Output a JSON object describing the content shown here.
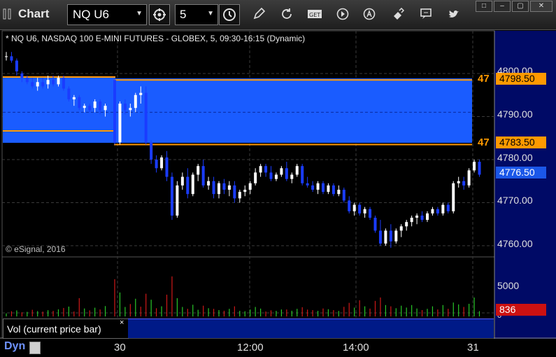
{
  "window": {
    "title": "Chart",
    "close_label": "✕"
  },
  "toolbar": {
    "symbol": "NQ U6",
    "interval": "5",
    "tools": [
      "link-icon",
      "pencil-icon",
      "refresh-icon",
      "get-icon",
      "play-icon",
      "alert-icon",
      "drawing-icon",
      "comment-icon",
      "twitter-icon"
    ]
  },
  "chart": {
    "header": "* NQ U6, NASDAQ 100 E-MINI FUTURES - GLOBEX, 5, 09:30-16:15 (Dynamic)",
    "copyright": "© eSignal, 2016",
    "price_axis": [
      "4800.00",
      "4790.00",
      "4780.00",
      "4770.00",
      "4760.00"
    ],
    "price_tags": {
      "upper": "4798.50",
      "lower": "4783.50",
      "last": "4776.50"
    },
    "zone_labels": {
      "upper": "47",
      "lower": "47"
    },
    "colors": {
      "zone": "#1a5cff",
      "zone_border": "#ff9900",
      "up": "#ffffff",
      "down": "#1a3cff",
      "last_tag": "#1b57e8"
    }
  },
  "volume": {
    "label": "Vol (current price bar)",
    "close": "×",
    "axis": [
      "5000",
      "0"
    ],
    "last_value": "836",
    "colors": {
      "up": "#28c728",
      "down": "#d01818",
      "tag": "#cc1111"
    }
  },
  "footer": {
    "mode": "Dyn",
    "time_labels": [
      "30",
      "12:00",
      "14:00",
      "31"
    ]
  },
  "chart_data": {
    "type": "candlestick",
    "interval": "5",
    "symbol": "NQ U6",
    "ylim": [
      4758,
      4808
    ],
    "horizontal_lines": [
      4798.5,
      4783.5
    ],
    "last_price": 4776.5,
    "bars": [
      [
        4804,
        4805,
        4803,
        4804
      ],
      [
        4804,
        4805,
        4802.5,
        4803
      ],
      [
        4803,
        4803.5,
        4799.5,
        4800.5
      ],
      [
        4800,
        4800.5,
        4798,
        4799
      ],
      [
        4799,
        4799.5,
        4797.5,
        4798
      ],
      [
        4798,
        4799,
        4796.5,
        4797
      ],
      [
        4797,
        4799,
        4796,
        4798
      ],
      [
        4798,
        4799,
        4796.5,
        4797
      ],
      [
        4797.5,
        4799.5,
        4796.5,
        4798.5
      ],
      [
        4798.5,
        4799.5,
        4797,
        4797.5
      ],
      [
        4797.5,
        4799.5,
        4797,
        4799
      ],
      [
        4799,
        4799.5,
        4796,
        4796.5
      ],
      [
        4796.5,
        4797,
        4793.5,
        4794
      ],
      [
        4794,
        4795,
        4792.5,
        4794.5
      ],
      [
        4794.5,
        4795,
        4791.5,
        4792
      ],
      [
        4792,
        4793,
        4791,
        4792.5
      ],
      [
        4792.5,
        4793,
        4791,
        4791.5
      ],
      [
        4792,
        4794,
        4791,
        4793.5
      ],
      [
        4793.5,
        4794,
        4790.5,
        4791.5
      ],
      [
        4791.5,
        4793,
        4790,
        4792.5
      ],
      [
        4798.5,
        4799,
        4783.5,
        4784
      ],
      [
        4784,
        4793.5,
        4783.5,
        4793
      ],
      [
        4793,
        4794,
        4790.5,
        4791.5
      ],
      [
        4791.5,
        4793,
        4790,
        4792
      ],
      [
        4792,
        4795.5,
        4791,
        4795
      ],
      [
        4795,
        4797,
        4793,
        4795.5
      ],
      [
        4795.5,
        4797,
        4783.5,
        4784
      ],
      [
        4784,
        4784.5,
        4779,
        4780
      ],
      [
        4780,
        4781,
        4777,
        4778
      ],
      [
        4778,
        4781,
        4777.5,
        4780.5
      ],
      [
        4780.5,
        4782,
        4775,
        4776
      ],
      [
        4776,
        4777,
        4766,
        4767
      ],
      [
        4767,
        4775,
        4766.5,
        4774
      ],
      [
        4774,
        4777,
        4773,
        4776
      ],
      [
        4776,
        4778,
        4771,
        4772
      ],
      [
        4772,
        4777,
        4771.5,
        4776.5
      ],
      [
        4776.5,
        4779,
        4775,
        4778.5
      ],
      [
        4778.5,
        4780,
        4773.5,
        4774
      ],
      [
        4774,
        4776,
        4773,
        4775
      ],
      [
        4775,
        4776,
        4771,
        4772
      ],
      [
        4772,
        4775,
        4771,
        4774.5
      ],
      [
        4774.5,
        4775.5,
        4772,
        4773
      ],
      [
        4773,
        4775,
        4771.5,
        4774
      ],
      [
        4774,
        4775,
        4770,
        4771
      ],
      [
        4771,
        4773,
        4770,
        4772.5
      ],
      [
        4772.5,
        4774,
        4771.5,
        4773
      ],
      [
        4773,
        4775,
        4772,
        4774.5
      ],
      [
        4774.5,
        4778,
        4774,
        4777
      ],
      [
        4777,
        4779,
        4776,
        4778.5
      ],
      [
        4778.5,
        4779,
        4776,
        4777
      ],
      [
        4777,
        4778.5,
        4775,
        4775.5
      ],
      [
        4775.5,
        4777,
        4775,
        4776.5
      ],
      [
        4776.5,
        4778.5,
        4776,
        4778
      ],
      [
        4778,
        4779.5,
        4775,
        4775.5
      ],
      [
        4775.5,
        4777,
        4774.5,
        4776.5
      ],
      [
        4776.5,
        4779,
        4776,
        4778.5
      ],
      [
        4778.5,
        4779,
        4774,
        4774.5
      ],
      [
        4774.5,
        4776,
        4773.5,
        4774
      ],
      [
        4774,
        4775,
        4772.5,
        4773
      ],
      [
        4773,
        4775,
        4772,
        4774.5
      ],
      [
        4774.5,
        4775,
        4772,
        4772.5
      ],
      [
        4772.5,
        4774.5,
        4772,
        4774
      ],
      [
        4774,
        4774.5,
        4771.5,
        4772
      ],
      [
        4772,
        4774,
        4771.5,
        4773
      ],
      [
        4773,
        4773.5,
        4770,
        4770.5
      ],
      [
        4770.5,
        4771.5,
        4767.5,
        4768
      ],
      [
        4768,
        4770,
        4767,
        4769.5
      ],
      [
        4769.5,
        4770,
        4767,
        4767.5
      ],
      [
        4767.5,
        4769,
        4766.5,
        4768.5
      ],
      [
        4768.5,
        4769,
        4766,
        4766.5
      ],
      [
        4766.5,
        4767,
        4763,
        4763.5
      ],
      [
        4763.5,
        4766,
        4760,
        4760.5
      ],
      [
        4760.5,
        4764,
        4760,
        4763.5
      ],
      [
        4763.5,
        4765,
        4759.5,
        4761
      ],
      [
        4761,
        4764,
        4760.5,
        4763.5
      ],
      [
        4763.5,
        4765,
        4762,
        4764.5
      ],
      [
        4764.5,
        4766,
        4763.5,
        4765.5
      ],
      [
        4765.5,
        4767,
        4764.5,
        4766.5
      ],
      [
        4766.5,
        4767.5,
        4765,
        4767
      ],
      [
        4767,
        4768,
        4765.5,
        4766
      ],
      [
        4766,
        4768,
        4765.5,
        4767.5
      ],
      [
        4767.5,
        4769,
        4767,
        4768.5
      ],
      [
        4768.5,
        4769,
        4767,
        4767.5
      ],
      [
        4767.5,
        4770,
        4767,
        4769.5
      ],
      [
        4769.5,
        4770,
        4767.5,
        4768
      ],
      [
        4768,
        4775,
        4767.5,
        4774.5
      ],
      [
        4774.5,
        4776,
        4773.5,
        4775
      ],
      [
        4775,
        4776,
        4773,
        4774
      ],
      [
        4774,
        4778,
        4773.5,
        4777.5
      ],
      [
        4777.5,
        4780,
        4777,
        4779.5
      ],
      [
        4779.5,
        4780,
        4776,
        4776.5
      ]
    ],
    "volume": [
      [
        480,
        1
      ],
      [
        820,
        0
      ],
      [
        950,
        1
      ],
      [
        650,
        0
      ],
      [
        720,
        1
      ],
      [
        1050,
        0
      ],
      [
        840,
        1
      ],
      [
        760,
        0
      ],
      [
        980,
        1
      ],
      [
        880,
        0
      ],
      [
        1120,
        1
      ],
      [
        1340,
        0
      ],
      [
        1560,
        1
      ],
      [
        780,
        0
      ],
      [
        2900,
        0
      ],
      [
        1260,
        1
      ],
      [
        960,
        0
      ],
      [
        1380,
        1
      ],
      [
        1100,
        0
      ],
      [
        1640,
        1
      ],
      [
        5900,
        0
      ],
      [
        3800,
        1
      ],
      [
        1500,
        1
      ],
      [
        1960,
        0
      ],
      [
        2800,
        1
      ],
      [
        1540,
        0
      ],
      [
        3600,
        0
      ],
      [
        2650,
        1
      ],
      [
        1300,
        0
      ],
      [
        1600,
        1
      ],
      [
        3450,
        0
      ],
      [
        6350,
        0
      ],
      [
        2900,
        1
      ],
      [
        1500,
        1
      ],
      [
        1200,
        0
      ],
      [
        1850,
        1
      ],
      [
        1050,
        1
      ],
      [
        1700,
        0
      ],
      [
        1300,
        1
      ],
      [
        1200,
        0
      ],
      [
        1000,
        1
      ],
      [
        900,
        0
      ],
      [
        1200,
        1
      ],
      [
        1600,
        0
      ],
      [
        880,
        1
      ],
      [
        820,
        1
      ],
      [
        1100,
        1
      ],
      [
        1500,
        1
      ],
      [
        1240,
        1
      ],
      [
        780,
        0
      ],
      [
        960,
        0
      ],
      [
        880,
        1
      ],
      [
        1100,
        1
      ],
      [
        1100,
        0
      ],
      [
        900,
        1
      ],
      [
        1200,
        1
      ],
      [
        1460,
        0
      ],
      [
        1080,
        0
      ],
      [
        1000,
        0
      ],
      [
        880,
        1
      ],
      [
        1260,
        0
      ],
      [
        1140,
        1
      ],
      [
        1000,
        0
      ],
      [
        860,
        1
      ],
      [
        1520,
        0
      ],
      [
        2150,
        0
      ],
      [
        1400,
        1
      ],
      [
        2560,
        0
      ],
      [
        1600,
        1
      ],
      [
        1240,
        0
      ],
      [
        2460,
        0
      ],
      [
        3000,
        0
      ],
      [
        1800,
        1
      ],
      [
        1600,
        0
      ],
      [
        1300,
        1
      ],
      [
        1700,
        1
      ],
      [
        1400,
        1
      ],
      [
        1800,
        1
      ],
      [
        1260,
        1
      ],
      [
        1000,
        0
      ],
      [
        1200,
        1
      ],
      [
        1600,
        1
      ],
      [
        1100,
        0
      ],
      [
        1800,
        1
      ],
      [
        1200,
        0
      ],
      [
        2200,
        1
      ],
      [
        1900,
        1
      ],
      [
        1500,
        0
      ],
      [
        2000,
        1
      ],
      [
        3000,
        1
      ],
      [
        836,
        1
      ]
    ]
  }
}
